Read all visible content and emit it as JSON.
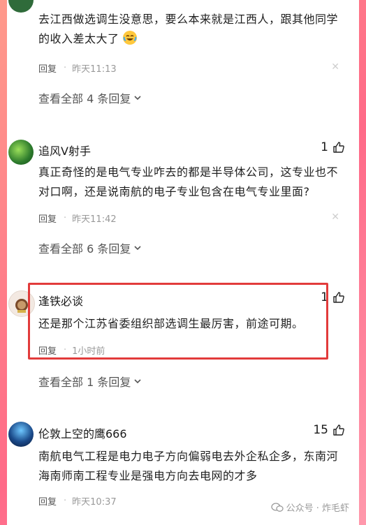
{
  "comments": [
    {
      "username": "",
      "likes": "",
      "text": "去江西做选调生没意思，要么本来就是江西人，跟其他同学的收入差太大了",
      "emoji": "laughing-crying-emoji",
      "reply": "回复",
      "time": "昨天11:13",
      "view_all": "查看全部 4 条回复"
    },
    {
      "username": "追风V射手",
      "likes": "1",
      "text": "真正奇怪的是电气专业咋去的都是半导体公司，这专业也不对口啊，还是说南航的电子专业包含在电气专业里面?",
      "reply": "回复",
      "time": "昨天11:42",
      "view_all": "查看全部 6 条回复"
    },
    {
      "username": "逢铁必谈",
      "likes": "1",
      "text": "还是那个江苏省委组织部选调生最厉害，前途可期。",
      "reply": "回复",
      "time": "1小时前",
      "view_all": "查看全部 1 条回复"
    },
    {
      "username": "伦敦上空的鹰666",
      "likes": "15",
      "text": "南航电气工程是电力电子方向偏弱电去外企私企多，东南河海南师南工程专业是强电方向去电网的才多",
      "reply": "回复",
      "time": "昨天10:37"
    }
  ],
  "watermark": {
    "label": "公众号 · 炸毛虾"
  },
  "colors": {
    "highlight": "#e23b3b",
    "background_gradient": [
      "#ff9a8b",
      "#ff6a88",
      "#ff99ac"
    ]
  }
}
